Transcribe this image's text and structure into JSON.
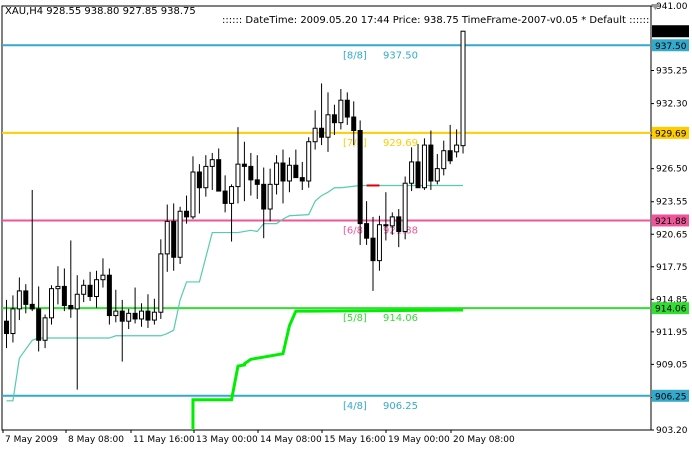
{
  "header": {
    "symbol_line": "XAU,H4  928.55 938.80 927.85 938.75",
    "info_line": ":::::: DateTime: 2009.05.20 17:44    Price: 938.75    TimeFrame-2007-v0.05     *  Default  ::::::"
  },
  "colors": {
    "background": "#ffffff",
    "candle": "#000000",
    "level_8_8": "#33aacc",
    "level_7_8": "#ffcc00",
    "level_6_8": "#ee5599",
    "level_5_8": "#33dd33",
    "level_4_8": "#33aacc",
    "trailing_stop": "#55ccaa",
    "green_step": "#00ee00",
    "current_price_bg": "#000000"
  },
  "chart_data": {
    "type": "candlestick",
    "symbol": "XAU",
    "timeframe": "H4",
    "ylim": [
      903.2,
      941.0
    ],
    "y_ticks": [
      941.0,
      935.25,
      932.3,
      929.45,
      926.5,
      923.55,
      920.65,
      917.75,
      914.85,
      911.95,
      909.05,
      906.1,
      903.2
    ],
    "x_labels": [
      "7 May 2009",
      "8 May 08:00",
      "11 May 16:00",
      "13 May 00:00",
      "14 May 08:00",
      "15 May 16:00",
      "19 May 00:00",
      "20 May 08:00"
    ],
    "candles": [
      [
        912.9,
        914.8,
        910.5,
        911.8
      ],
      [
        911.8,
        915.2,
        911.0,
        914.0
      ],
      [
        914.0,
        916.8,
        913.0,
        915.6
      ],
      [
        915.6,
        916.2,
        913.6,
        914.4
      ],
      [
        914.4,
        924.6,
        913.8,
        914.0
      ],
      [
        914.0,
        916.0,
        910.2,
        911.2
      ],
      [
        911.2,
        913.5,
        910.5,
        913.2
      ],
      [
        913.2,
        916.1,
        912.6,
        915.8
      ],
      [
        915.8,
        917.8,
        914.4,
        916.0
      ],
      [
        916.0,
        917.6,
        913.8,
        914.3
      ],
      [
        914.3,
        920.1,
        913.2,
        914.0
      ],
      [
        914.0,
        917.0,
        906.8,
        915.3
      ],
      [
        915.3,
        916.6,
        914.6,
        916.1
      ],
      [
        916.1,
        917.3,
        914.7,
        915.1
      ],
      [
        915.1,
        917.4,
        914.1,
        916.6
      ],
      [
        916.6,
        918.5,
        915.9,
        917.0
      ],
      [
        917.0,
        917.6,
        912.6,
        913.4
      ],
      [
        913.4,
        915.7,
        912.8,
        913.8
      ],
      [
        913.8,
        914.8,
        909.3,
        912.9
      ],
      [
        912.9,
        914.0,
        912.2,
        913.6
      ],
      [
        913.6,
        915.9,
        912.7,
        913.1
      ],
      [
        913.1,
        914.5,
        912.4,
        913.8
      ],
      [
        913.8,
        915.3,
        912.3,
        913.0
      ],
      [
        913.0,
        914.9,
        912.6,
        913.7
      ],
      [
        913.7,
        920.2,
        913.1,
        918.9
      ],
      [
        918.9,
        923.3,
        917.3,
        921.8
      ],
      [
        921.8,
        923.4,
        917.4,
        918.6
      ],
      [
        918.6,
        923.1,
        918.0,
        922.7
      ],
      [
        922.7,
        924.1,
        921.6,
        922.2
      ],
      [
        922.2,
        927.6,
        922.0,
        926.2
      ],
      [
        926.2,
        926.9,
        922.5,
        924.8
      ],
      [
        924.8,
        927.7,
        924.0,
        926.7
      ],
      [
        926.7,
        927.9,
        924.6,
        927.3
      ],
      [
        927.3,
        928.3,
        925.3,
        924.5
      ],
      [
        924.5,
        925.9,
        922.6,
        923.4
      ],
      [
        923.4,
        925.1,
        920.0,
        924.9
      ],
      [
        924.9,
        930.2,
        923.4,
        926.9
      ],
      [
        926.9,
        928.9,
        923.6,
        926.7
      ],
      [
        926.7,
        927.9,
        924.1,
        925.5
      ],
      [
        925.5,
        927.7,
        923.8,
        925.1
      ],
      [
        925.1,
        926.6,
        920.3,
        922.9
      ],
      [
        922.9,
        926.5,
        921.8,
        925.1
      ],
      [
        925.1,
        927.7,
        924.2,
        927.0
      ],
      [
        927.0,
        928.2,
        923.4,
        925.4
      ],
      [
        925.4,
        927.5,
        924.4,
        926.8
      ],
      [
        926.8,
        928.2,
        925.7,
        925.7
      ],
      [
        925.7,
        927.1,
        924.6,
        925.4
      ],
      [
        925.4,
        929.3,
        924.8,
        928.9
      ],
      [
        928.9,
        931.7,
        928.2,
        930.1
      ],
      [
        930.1,
        934.1,
        928.6,
        929.3
      ],
      [
        929.3,
        933.3,
        928.0,
        931.3
      ],
      [
        931.3,
        932.2,
        929.5,
        930.6
      ],
      [
        930.6,
        933.6,
        930.0,
        932.6
      ],
      [
        932.6,
        933.3,
        930.4,
        931.1
      ],
      [
        931.1,
        932.5,
        928.6,
        929.9
      ],
      [
        929.9,
        930.8,
        919.7,
        921.6
      ],
      [
        921.6,
        923.6,
        919.7,
        920.3
      ],
      [
        920.3,
        922.2,
        915.6,
        918.3
      ],
      [
        918.3,
        922.3,
        917.4,
        921.5
      ],
      [
        921.5,
        924.4,
        920.1,
        921.4
      ],
      [
        921.4,
        922.6,
        920.6,
        922.2
      ],
      [
        922.2,
        922.9,
        919.5,
        920.9
      ],
      [
        920.9,
        925.8,
        920.2,
        925.2
      ],
      [
        925.2,
        928.4,
        924.5,
        927.1
      ],
      [
        927.1,
        928.7,
        924.8,
        924.8
      ],
      [
        924.8,
        929.2,
        924.6,
        928.6
      ],
      [
        928.6,
        929.9,
        924.6,
        925.4
      ],
      [
        925.4,
        927.8,
        925.1,
        926.5
      ],
      [
        926.5,
        929.0,
        925.9,
        928.1
      ],
      [
        928.1,
        930.4,
        926.9,
        927.2
      ],
      [
        928.0,
        930.0,
        927.5,
        928.6
      ],
      [
        928.55,
        938.8,
        927.85,
        938.75
      ]
    ],
    "murrey_levels": [
      {
        "label": "[8/8]",
        "value": "937.50",
        "price": 937.5
      },
      {
        "label": "[7/8]",
        "value": "929.69",
        "price": 929.69
      },
      {
        "label": "[6/8]",
        "value": "921.88",
        "price": 921.88
      },
      {
        "label": "[5/8]",
        "value": "914.06",
        "price": 914.06
      },
      {
        "label": "[4/8]",
        "value": "906.25",
        "price": 906.25
      }
    ],
    "price_tags": [
      "938.75",
      "937.50",
      "929.69",
      "921.88",
      "914.06",
      "906.25"
    ],
    "trailing_stop": [
      [
        0,
        905.8
      ],
      [
        1,
        905.8
      ],
      [
        2,
        909.6
      ],
      [
        4,
        911.2
      ],
      [
        5,
        911.4
      ],
      [
        6,
        911.4
      ],
      [
        14,
        911.4
      ],
      [
        16,
        911.4
      ],
      [
        17,
        911.6
      ],
      [
        24,
        911.6
      ],
      [
        25,
        911.8
      ],
      [
        26,
        912.1
      ],
      [
        27,
        914.8
      ],
      [
        28,
        916.4
      ],
      [
        30,
        916.4
      ],
      [
        31,
        918.6
      ],
      [
        32,
        920.8
      ],
      [
        33,
        920.8
      ],
      [
        34,
        920.8
      ],
      [
        36,
        920.8
      ],
      [
        37,
        920.9
      ],
      [
        38,
        921.0
      ],
      [
        39,
        920.9
      ],
      [
        40,
        921.6
      ],
      [
        42,
        921.6
      ],
      [
        43,
        922.0
      ],
      [
        44,
        922.3
      ],
      [
        47,
        922.4
      ],
      [
        48,
        923.6
      ],
      [
        49,
        924.1
      ],
      [
        50,
        924.4
      ],
      [
        51,
        924.8
      ],
      [
        52,
        924.8
      ],
      [
        55,
        925.0
      ],
      [
        57,
        925.0
      ],
      [
        60,
        925.0
      ],
      [
        62,
        925.0
      ],
      [
        71,
        925.0
      ]
    ],
    "trailing_stop_red_segment": [
      [
        56,
        925.0
      ],
      [
        58,
        925.0
      ]
    ],
    "green_steps": [
      [
        29,
        903.2
      ],
      [
        29,
        905.9
      ],
      [
        30,
        905.9
      ],
      [
        35,
        905.9
      ],
      [
        36,
        908.9
      ],
      [
        37,
        909.0
      ],
      [
        37,
        909.1
      ],
      [
        38,
        909.5
      ],
      [
        43,
        910.0
      ],
      [
        44,
        912.5
      ],
      [
        45,
        913.8
      ],
      [
        46,
        913.8
      ],
      [
        47,
        913.8
      ],
      [
        71,
        913.9
      ]
    ]
  }
}
